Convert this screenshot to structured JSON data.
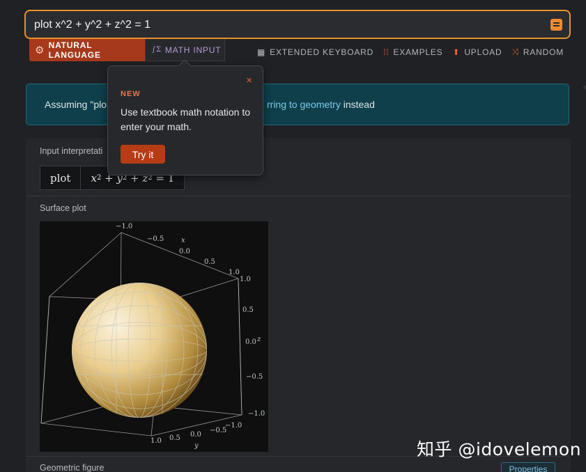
{
  "search": {
    "query": "plot x^2 + y^2 + z^2 = 1"
  },
  "modes": {
    "natural_language": "NATURAL LANGUAGE",
    "math_input": "MATH INPUT"
  },
  "toolbar": {
    "extended_keyboard": "EXTENDED KEYBOARD",
    "examples": "EXAMPLES",
    "upload": "UPLOAD",
    "random": "RANDOM"
  },
  "assumption": {
    "prefix": "Assuming \"plo",
    "link": "rring to geometry",
    "suffix": " instead"
  },
  "popup": {
    "badge": "NEW",
    "message": "Use textbook math notation to enter your math.",
    "button": "Try it",
    "close": "×"
  },
  "pods": {
    "input_interpretation": {
      "title": "Input interpretati",
      "cell1": "plot"
    },
    "surface_plot": {
      "title": "Surface plot",
      "x_label": "x",
      "y_label": "y",
      "z_label": "z",
      "x_ticks": [
        "−1.0",
        "−0.5",
        "0.0",
        "0.5",
        "1.0"
      ],
      "y_ticks": [
        "1.0",
        "0.5",
        "0.0",
        "−0.5",
        "−1.0"
      ],
      "z_ticks": [
        "1.0",
        "0.5",
        "0.0",
        "−0.5",
        "−1.0"
      ]
    },
    "geometric_figure": {
      "title": "Geometric figure",
      "properties_button": "Properties"
    }
  },
  "watermark": "知乎 @idovelemon",
  "colors": {
    "accent": "#e8922a",
    "tab_active": "#a6391c",
    "banner_bg": "#0e3f4b",
    "link": "#7ec8ea",
    "sphere_light": "#fbf3e0",
    "sphere_dark": "#7a5a20"
  }
}
